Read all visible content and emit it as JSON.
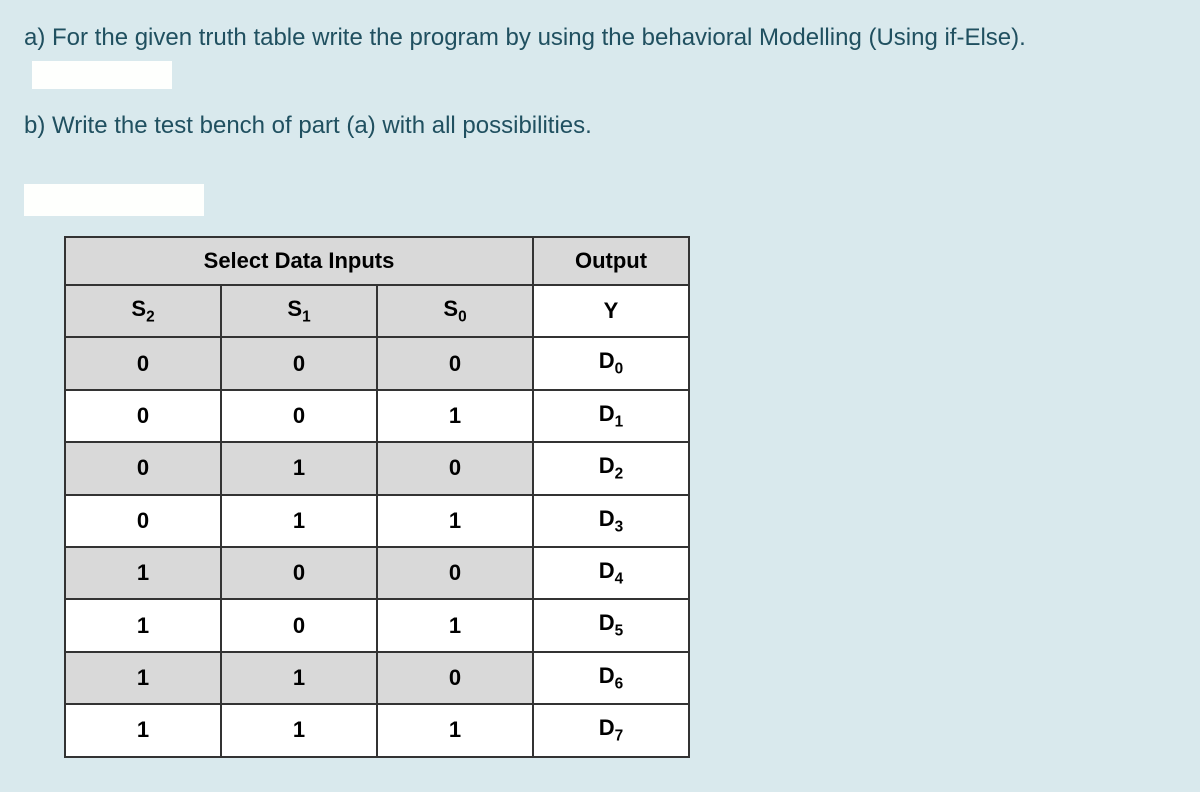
{
  "questions": {
    "a": "a) For the given truth table write the program by using the behavioral Modelling (Using if-Else).",
    "b": "b) Write the test bench of  part (a) with all possibilities."
  },
  "table": {
    "header_select": "Select Data Inputs",
    "header_output": "Output",
    "col_s2": "S",
    "col_s2_sub": "2",
    "col_s1": "S",
    "col_s1_sub": "1",
    "col_s0": "S",
    "col_s0_sub": "0",
    "col_y": "Y",
    "rows": [
      {
        "s2": "0",
        "s1": "0",
        "s0": "0",
        "y_base": "D",
        "y_sub": "0",
        "shaded": true
      },
      {
        "s2": "0",
        "s1": "0",
        "s0": "1",
        "y_base": "D",
        "y_sub": "1",
        "shaded": false
      },
      {
        "s2": "0",
        "s1": "1",
        "s0": "0",
        "y_base": "D",
        "y_sub": "2",
        "shaded": true
      },
      {
        "s2": "0",
        "s1": "1",
        "s0": "1",
        "y_base": "D",
        "y_sub": "3",
        "shaded": false
      },
      {
        "s2": "1",
        "s1": "0",
        "s0": "0",
        "y_base": "D",
        "y_sub": "4",
        "shaded": true
      },
      {
        "s2": "1",
        "s1": "0",
        "s0": "1",
        "y_base": "D",
        "y_sub": "5",
        "shaded": false
      },
      {
        "s2": "1",
        "s1": "1",
        "s0": "0",
        "y_base": "D",
        "y_sub": "6",
        "shaded": true
      },
      {
        "s2": "1",
        "s1": "1",
        "s0": "1",
        "y_base": "D",
        "y_sub": "7",
        "shaded": false
      }
    ]
  }
}
